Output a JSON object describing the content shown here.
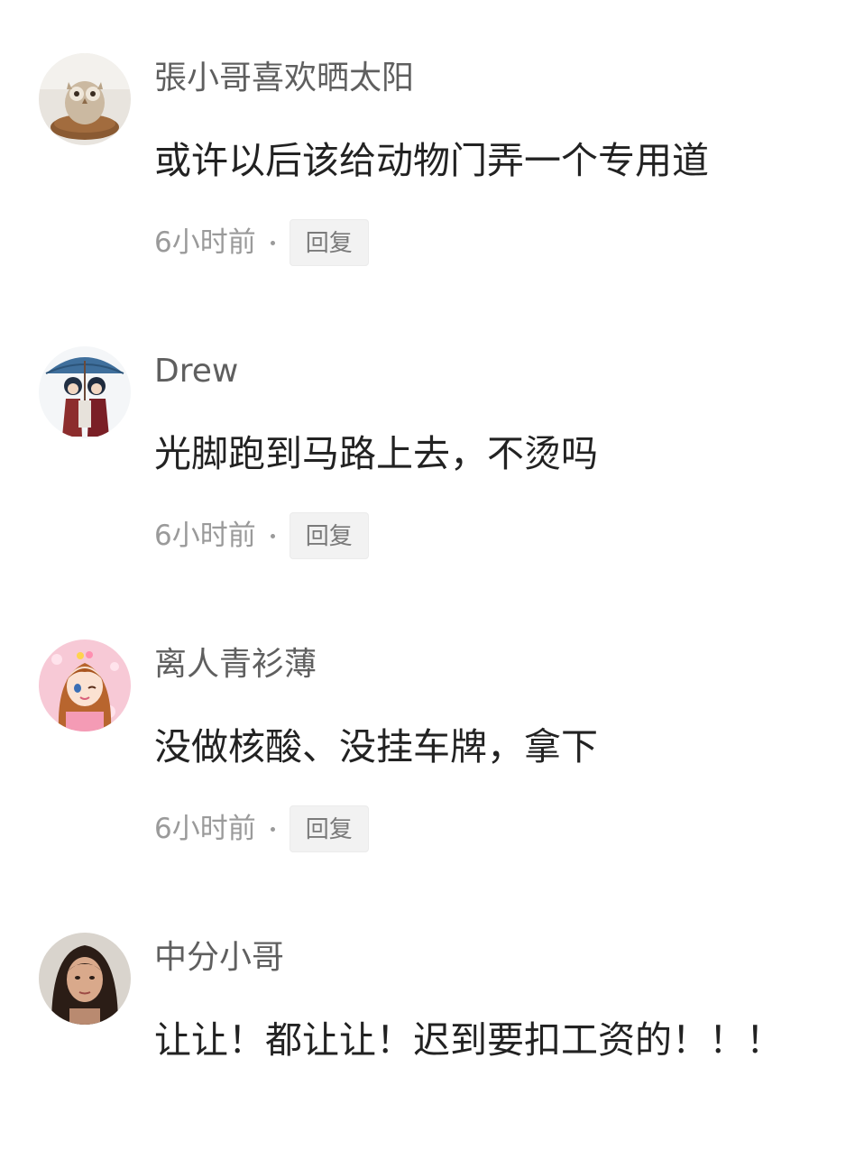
{
  "comments": [
    {
      "avatar_icon": "owl-figurine-avatar-icon",
      "username": "張小哥喜欢晒太阳",
      "content": "或许以后该给动物门弄一个专用道",
      "time": "6小时前",
      "reply_label": "回复"
    },
    {
      "avatar_icon": "anime-couple-avatar-icon",
      "username": "Drew",
      "content": "光脚跑到马路上去，不烫吗",
      "time": "6小时前",
      "reply_label": "回复"
    },
    {
      "avatar_icon": "anime-girl-avatar-icon",
      "username": "离人青衫薄",
      "content": "没做核酸、没挂车牌，拿下",
      "time": "6小时前",
      "reply_label": "回复"
    },
    {
      "avatar_icon": "woman-portrait-avatar-icon",
      "username": "中分小哥",
      "content": "让让！都让让！迟到要扣工资的！！！",
      "time": "",
      "reply_label": ""
    }
  ],
  "colors": {
    "username": "#5f5f5f",
    "content": "#222222",
    "meta": "#9a9a9a",
    "reply_bg": "#f2f2f2"
  }
}
